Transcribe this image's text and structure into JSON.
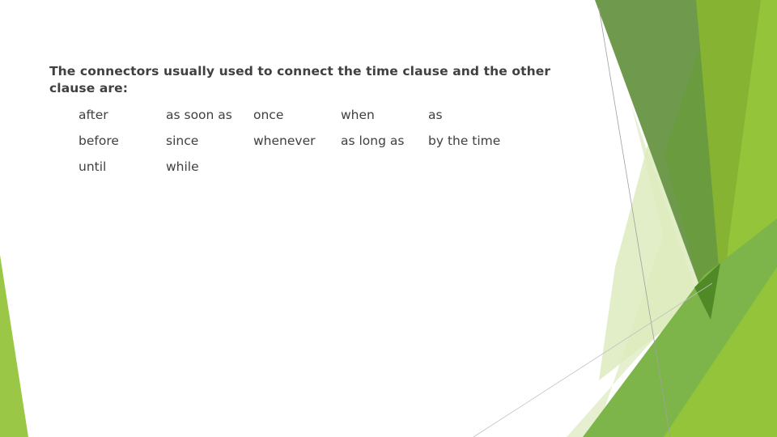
{
  "slide": {
    "heading": "The connectors usually used to connect the time clause and the other clause are:",
    "connectors": [
      [
        "after",
        "as soon as",
        "once",
        "when",
        "as"
      ],
      [
        "before",
        "since",
        "whenever",
        "as long as",
        "by the time"
      ],
      [
        "until",
        "while"
      ]
    ]
  },
  "theme": {
    "text_color": "#404040",
    "greens": [
      "#6f9a4e",
      "#6a9b3f",
      "#86b332",
      "#93c43a",
      "#9bc746",
      "#7db54b",
      "#d6e8b0",
      "#e6f0d0",
      "#4f8a26"
    ]
  }
}
